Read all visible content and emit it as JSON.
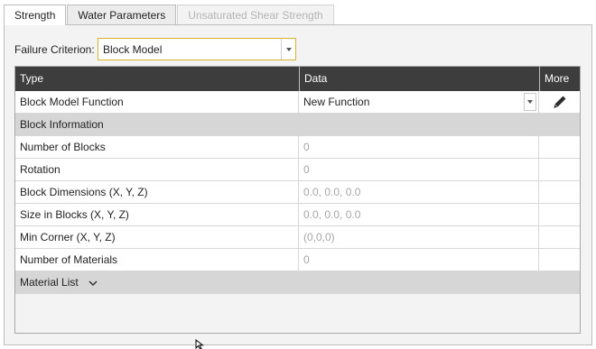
{
  "tabs": [
    {
      "label": "Strength"
    },
    {
      "label": "Water Parameters"
    },
    {
      "label": "Unsaturated Shear Strength"
    }
  ],
  "failure_criterion": {
    "label": "Failure Criterion:",
    "value": "Block Model"
  },
  "grid": {
    "headers": {
      "type": "Type",
      "data": "Data",
      "more": "More"
    },
    "block_model_function": {
      "label": "Block Model Function",
      "value": "New Function"
    },
    "block_information": {
      "label": "Block Information"
    },
    "rows": [
      {
        "label": "Number of Blocks",
        "value": "0"
      },
      {
        "label": "Rotation",
        "value": "0"
      },
      {
        "label": "Block Dimensions (X, Y, Z)",
        "value": "0.0, 0.0, 0.0"
      },
      {
        "label": "Size in Blocks (X, Y, Z)",
        "value": "0.0, 0.0, 0.0"
      },
      {
        "label": "Min Corner (X, Y, Z)",
        "value": "(0,0,0)"
      },
      {
        "label": "Number of Materials",
        "value": "0"
      }
    ],
    "material_list": {
      "label": "Material List"
    }
  },
  "icons": {
    "edit": "pencil-icon",
    "expand": "chevron-down-icon",
    "dropdown": "caret-down-icon"
  },
  "colors": {
    "header_bg": "#3d3d3d",
    "focus_border": "#d9b32c",
    "group_bg": "#d6d6d6"
  }
}
